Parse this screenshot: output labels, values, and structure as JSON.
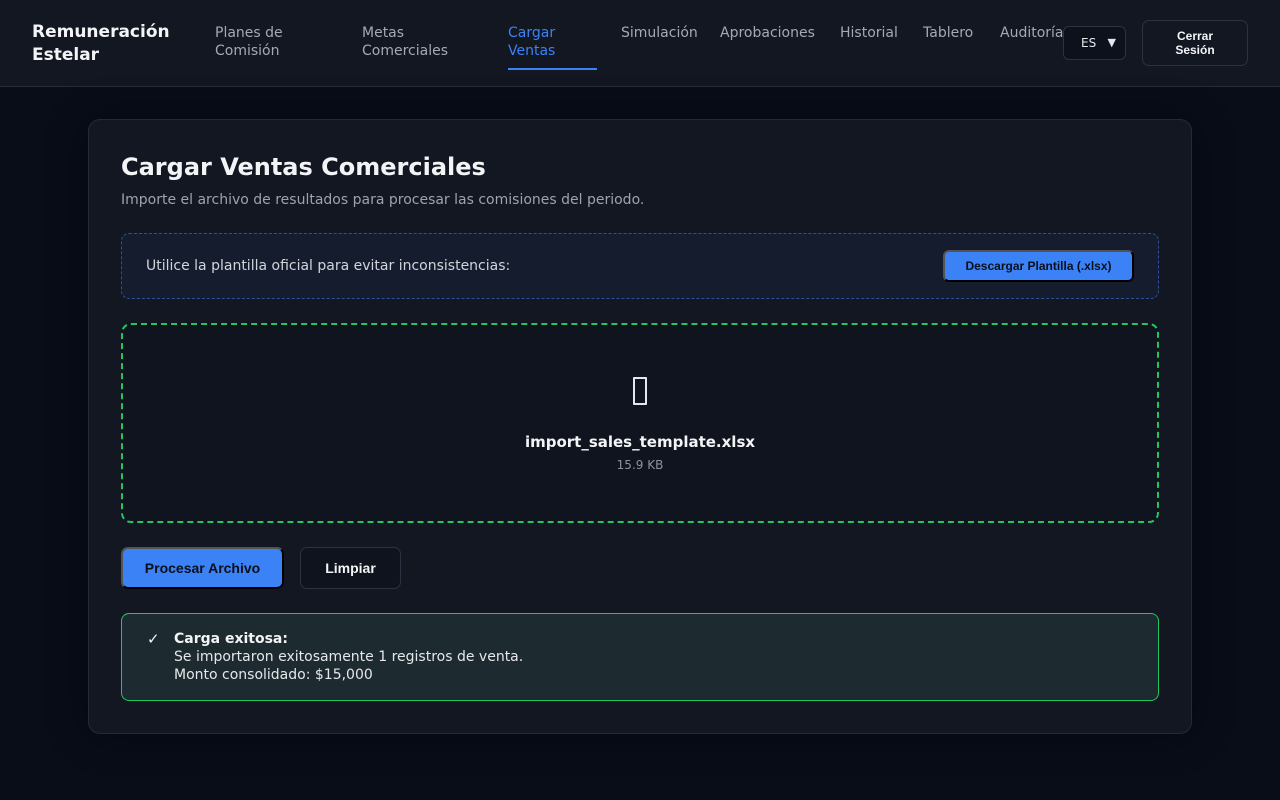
{
  "app": {
    "brand": "Remuneración Estelar"
  },
  "nav": {
    "items": [
      {
        "label": "Planes de Comisión"
      },
      {
        "label": "Metas Comerciales"
      },
      {
        "label": "Cargar Ventas"
      },
      {
        "label": "Simulación"
      },
      {
        "label": "Aprobaciones"
      },
      {
        "label": "Historial"
      },
      {
        "label": "Tablero"
      },
      {
        "label": "Auditoría"
      }
    ],
    "active_index": 2,
    "language": {
      "selected": "ES",
      "icon": "chevron-down-icon"
    },
    "logout_label": "Cerrar Sesión"
  },
  "page": {
    "title": "Cargar Ventas Comerciales",
    "subtitle": "Importe el archivo de resultados para procesar las comisiones del periodo.",
    "template": {
      "text": "Utilice la plantilla oficial para evitar inconsistencias:",
      "button_label": "Descargar Plantilla (.xlsx)"
    },
    "upload": {
      "icon": "file-icon",
      "file_name": "import_sales_template.xlsx",
      "file_size": "15.9 KB"
    },
    "actions": {
      "process_label": "Procesar Archivo",
      "clear_label": "Limpiar"
    },
    "result": {
      "icon": "check-icon",
      "title": "Carga exitosa:",
      "message": "Se importaron exitosamente 1 registros de venta.",
      "amount": "Monto consolidado: $15,000"
    }
  },
  "colors": {
    "accent": "#3b82f6",
    "success": "#22c55e",
    "background": "#080d18",
    "surface": "#121722"
  }
}
